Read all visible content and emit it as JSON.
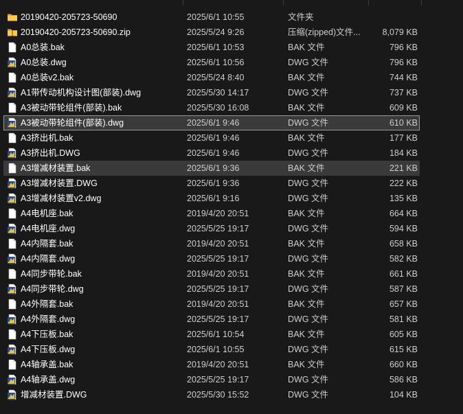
{
  "window": {
    "title": ""
  },
  "colors": {
    "background": "#191919",
    "selected_bg": "#3a3a3a",
    "selected_border": "#9a9a9a",
    "text_primary": "#ffffff",
    "text_secondary": "#cfcfcf",
    "folder_yellow": "#f0c040",
    "dwg_icon_blue": "#2b4a8c",
    "dwg_icon_yellow": "#e8c23a"
  },
  "files": [
    {
      "name": "20190420-205723-50690",
      "date": "2025/6/1 10:55",
      "type": "文件夹",
      "size": "",
      "icon": "folder-icon",
      "state": ""
    },
    {
      "name": "20190420-205723-50690.zip",
      "date": "2025/5/24 9:26",
      "type": "压缩(zipped)文件...",
      "size": "8,079 KB",
      "icon": "zip-folder-icon",
      "state": ""
    },
    {
      "name": "A0总装.bak",
      "date": "2025/6/1 10:53",
      "type": "BAK 文件",
      "size": "796 KB",
      "icon": "document-icon",
      "state": ""
    },
    {
      "name": "A0总装.dwg",
      "date": "2025/6/1 10:56",
      "type": "DWG 文件",
      "size": "796 KB",
      "icon": "dwg-file-icon",
      "state": ""
    },
    {
      "name": "A0总装v2.bak",
      "date": "2025/5/24 8:40",
      "type": "BAK 文件",
      "size": "744 KB",
      "icon": "document-icon",
      "state": ""
    },
    {
      "name": "A1带传动机构设计图(部装).dwg",
      "date": "2025/5/30 14:17",
      "type": "DWG 文件",
      "size": "737 KB",
      "icon": "dwg-file-icon",
      "state": ""
    },
    {
      "name": "A3被动带轮组件(部装).bak",
      "date": "2025/5/30 16:08",
      "type": "BAK 文件",
      "size": "609 KB",
      "icon": "document-icon",
      "state": ""
    },
    {
      "name": "A3被动带轮组件(部装).dwg",
      "date": "2025/6/1 9:46",
      "type": "DWG 文件",
      "size": "610 KB",
      "icon": "dwg-file-icon",
      "state": "selected"
    },
    {
      "name": "A3挤出机.bak",
      "date": "2025/6/1 9:46",
      "type": "BAK 文件",
      "size": "177 KB",
      "icon": "document-icon",
      "state": ""
    },
    {
      "name": "A3挤出机.DWG",
      "date": "2025/6/1 9:46",
      "type": "DWG 文件",
      "size": "184 KB",
      "icon": "dwg-file-icon",
      "state": ""
    },
    {
      "name": "A3增减材装置.bak",
      "date": "2025/6/1 9:36",
      "type": "BAK 文件",
      "size": "221 KB",
      "icon": "document-icon",
      "state": "hovered"
    },
    {
      "name": "A3增减材装置.DWG",
      "date": "2025/6/1 9:36",
      "type": "DWG 文件",
      "size": "222 KB",
      "icon": "dwg-file-icon",
      "state": ""
    },
    {
      "name": "A3增减材装置v2.dwg",
      "date": "2025/6/1 9:16",
      "type": "DWG 文件",
      "size": "135 KB",
      "icon": "dwg-file-icon",
      "state": ""
    },
    {
      "name": "A4电机座.bak",
      "date": "2019/4/20 20:51",
      "type": "BAK 文件",
      "size": "664 KB",
      "icon": "document-icon",
      "state": ""
    },
    {
      "name": "A4电机座.dwg",
      "date": "2025/5/25 19:17",
      "type": "DWG 文件",
      "size": "594 KB",
      "icon": "dwg-file-icon",
      "state": ""
    },
    {
      "name": "A4内隔套.bak",
      "date": "2019/4/20 20:51",
      "type": "BAK 文件",
      "size": "658 KB",
      "icon": "document-icon",
      "state": ""
    },
    {
      "name": "A4内隔套.dwg",
      "date": "2025/5/25 19:17",
      "type": "DWG 文件",
      "size": "582 KB",
      "icon": "dwg-file-icon",
      "state": ""
    },
    {
      "name": "A4同步带轮.bak",
      "date": "2019/4/20 20:51",
      "type": "BAK 文件",
      "size": "661 KB",
      "icon": "document-icon",
      "state": ""
    },
    {
      "name": "A4同步带轮.dwg",
      "date": "2025/5/25 19:17",
      "type": "DWG 文件",
      "size": "587 KB",
      "icon": "dwg-file-icon",
      "state": ""
    },
    {
      "name": "A4外隔套.bak",
      "date": "2019/4/20 20:51",
      "type": "BAK 文件",
      "size": "657 KB",
      "icon": "document-icon",
      "state": ""
    },
    {
      "name": "A4外隔套.dwg",
      "date": "2025/5/25 19:17",
      "type": "DWG 文件",
      "size": "581 KB",
      "icon": "dwg-file-icon",
      "state": ""
    },
    {
      "name": "A4下压板.bak",
      "date": "2025/6/1 10:54",
      "type": "BAK 文件",
      "size": "605 KB",
      "icon": "document-icon",
      "state": ""
    },
    {
      "name": "A4下压板.dwg",
      "date": "2025/6/1 10:55",
      "type": "DWG 文件",
      "size": "615 KB",
      "icon": "dwg-file-icon",
      "state": ""
    },
    {
      "name": "A4轴承盖.bak",
      "date": "2019/4/20 20:51",
      "type": "BAK 文件",
      "size": "660 KB",
      "icon": "document-icon",
      "state": ""
    },
    {
      "name": "A4轴承盖.dwg",
      "date": "2025/5/25 19:17",
      "type": "DWG 文件",
      "size": "586 KB",
      "icon": "dwg-file-icon",
      "state": ""
    },
    {
      "name": "增减材装置.DWG",
      "date": "2025/5/30 15:52",
      "type": "DWG 文件",
      "size": "104 KB",
      "icon": "dwg-file-icon",
      "state": ""
    }
  ]
}
